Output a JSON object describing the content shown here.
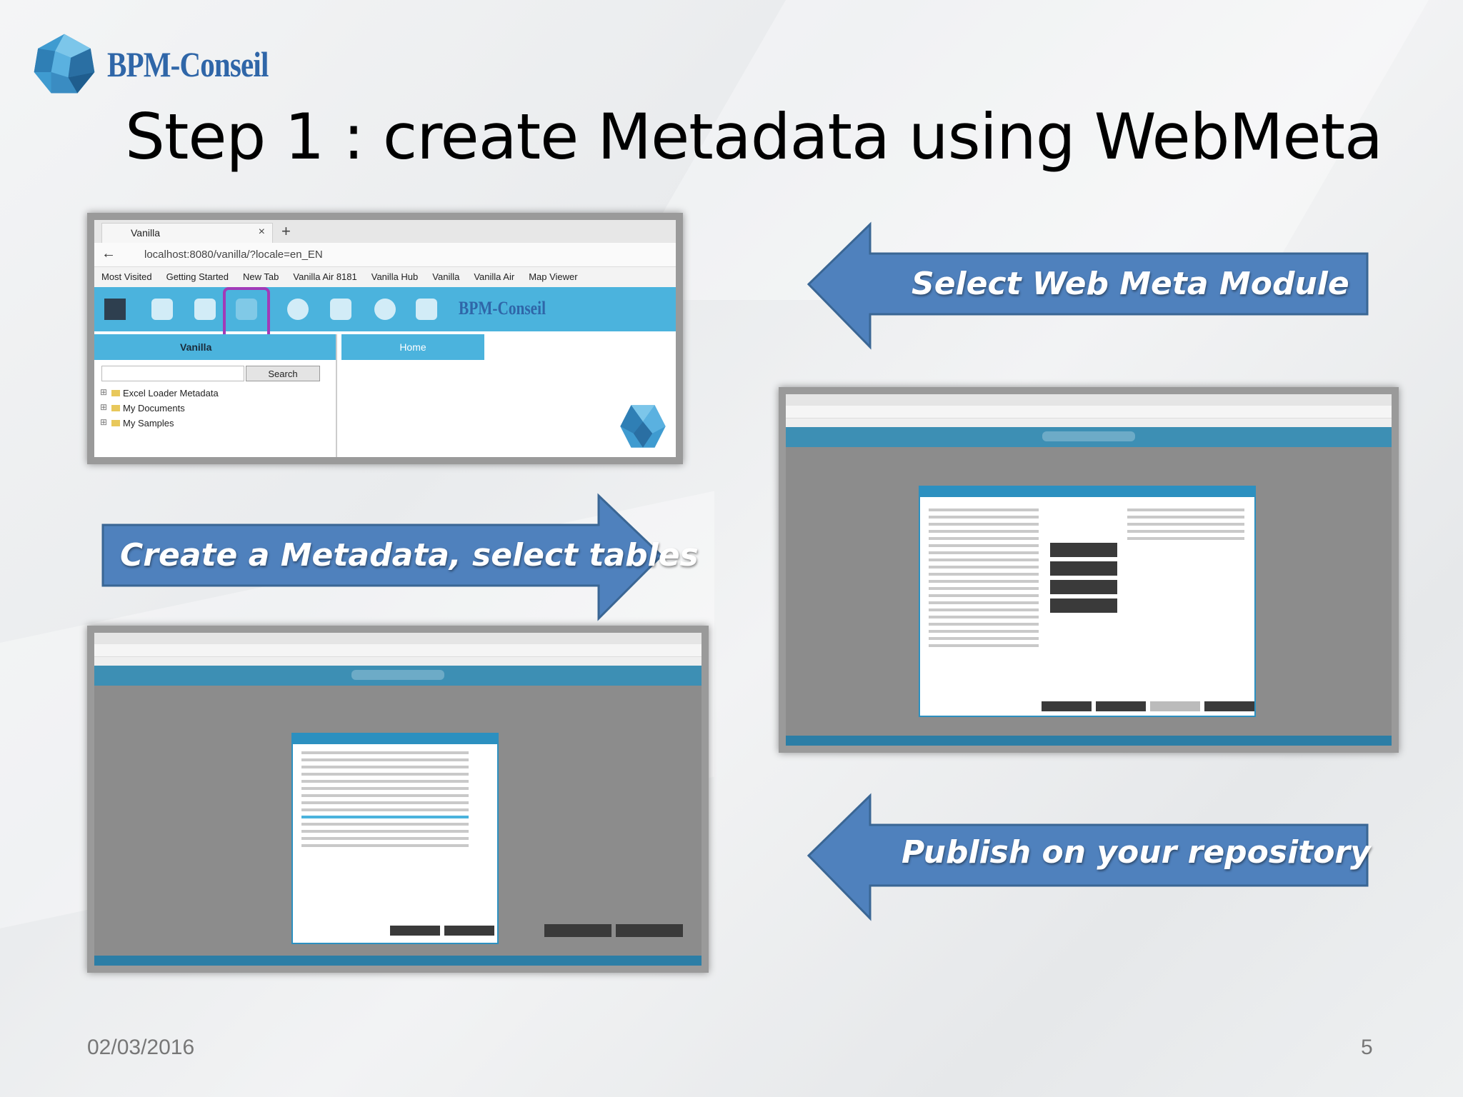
{
  "slide": {
    "logo_text": "BPM-Conseil",
    "title": "Step 1 : create Metadata using WebMeta",
    "date": "02/03/2016",
    "page_number": "5"
  },
  "callouts": {
    "select_module": "Select Web Meta Module",
    "create_metadata": "Create a Metadata, select tables",
    "publish": "Publish on your repository"
  },
  "colors": {
    "arrow_fill": "#4f81bd",
    "arrow_stroke": "#3a6694",
    "toolbar": "#4bb3dd",
    "brand": "#2f66a8",
    "highlight": "#a23ab8"
  },
  "screenshot_vanilla": {
    "tab_label": "Vanilla",
    "tab_close": "×",
    "new_tab": "+",
    "url": "localhost:8080/vanilla/?locale=en_EN",
    "bookmarks": [
      "Most Visited",
      "Getting Started",
      "New Tab",
      "Vanilla Air 8181",
      "Vanilla Hub",
      "Vanilla",
      "Vanilla Air",
      "Map Viewer"
    ],
    "toolbar_brand": "BPM-Conseil",
    "panel_title": "Vanilla",
    "search_button": "Search",
    "home_tab": "Home",
    "tree_items": [
      "Excel Loader Metadata",
      "My Documents",
      "My Samples"
    ]
  }
}
